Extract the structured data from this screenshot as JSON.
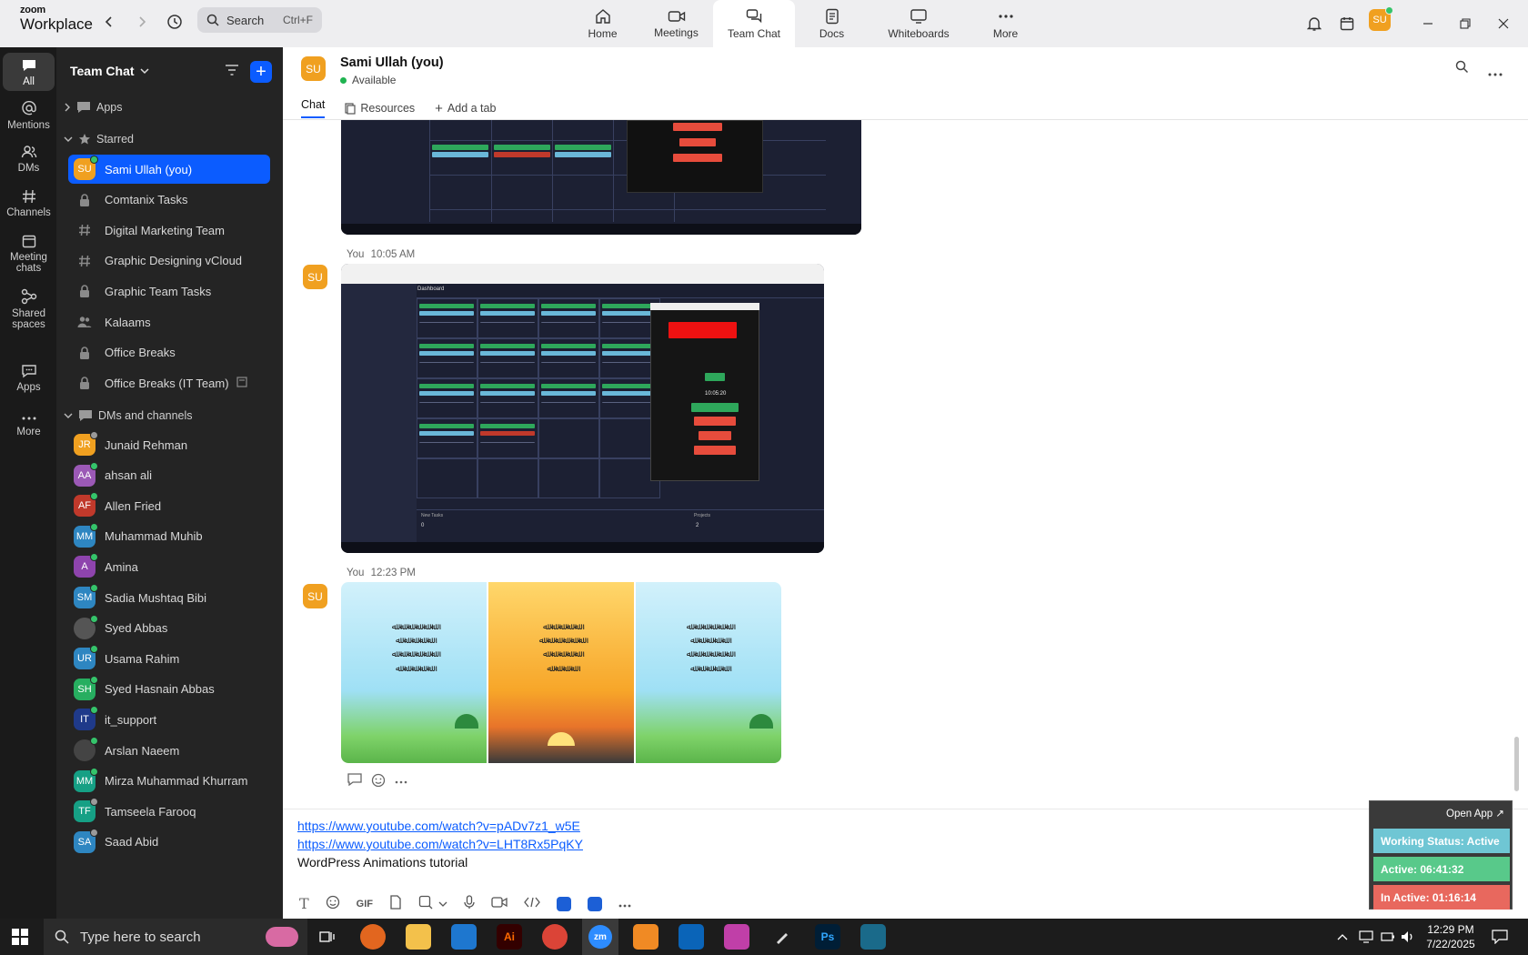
{
  "app": {
    "brand_top": "zoom",
    "brand_bottom": "Workplace",
    "search_label": "Search",
    "search_shortcut": "Ctrl+F",
    "user_initials": "SU"
  },
  "top_tabs": [
    {
      "label": "Home",
      "icon": "home-icon"
    },
    {
      "label": "Meetings",
      "icon": "video-icon"
    },
    {
      "label": "Team Chat",
      "icon": "chat-icon"
    },
    {
      "label": "Docs",
      "icon": "doc-icon"
    },
    {
      "label": "Whiteboards",
      "icon": "whiteboard-icon"
    },
    {
      "label": "More",
      "icon": "more-icon"
    }
  ],
  "rail": [
    {
      "label": "All"
    },
    {
      "label": "Mentions"
    },
    {
      "label": "DMs"
    },
    {
      "label": "Channels"
    },
    {
      "label": "Meeting chats"
    },
    {
      "label": "Shared spaces"
    },
    {
      "label": "Apps"
    },
    {
      "label": "More"
    }
  ],
  "sidebar": {
    "title": "Team Chat",
    "sections": {
      "apps": "Apps",
      "starred": "Starred",
      "dms": "DMs and channels"
    },
    "starred": [
      {
        "label": "Sami Ullah (you)",
        "type": "avatar",
        "initials": "SU",
        "color": "#f0a020",
        "status": "#35c46b",
        "selected": true
      },
      {
        "label": "Comtanix Tasks",
        "type": "lock"
      },
      {
        "label": "Digital Marketing Team",
        "type": "hash"
      },
      {
        "label": "Graphic Designing vCloud",
        "type": "hash"
      },
      {
        "label": "Graphic Team Tasks",
        "type": "lock"
      },
      {
        "label": "Kalaams",
        "type": "people"
      },
      {
        "label": "Office Breaks",
        "type": "lock"
      },
      {
        "label": "Office Breaks (IT Team)",
        "type": "lock"
      }
    ],
    "dms": [
      {
        "label": "Junaid Rehman",
        "initials": "JR",
        "color": "#f0a020",
        "status": "#9a9a9a"
      },
      {
        "label": "ahsan ali",
        "initials": "AA",
        "color": "#9b59b6",
        "status": "#35c46b"
      },
      {
        "label": "Allen Fried",
        "initials": "AF",
        "color": "#c0392b",
        "status": "#35c46b"
      },
      {
        "label": "Muhammad Muhib",
        "initials": "MM",
        "color": "#2e86c1",
        "status": "#35c46b"
      },
      {
        "label": "Amina",
        "initials": "A",
        "color": "#8e44ad",
        "status": "#35c46b"
      },
      {
        "label": "Sadia Mushtaq Bibi",
        "initials": "SM",
        "color": "#2e86c1",
        "status": "#35c46b"
      },
      {
        "label": "Syed Abbas",
        "initials": "",
        "color": "#555555",
        "status": "#35c46b"
      },
      {
        "label": "Usama Rahim",
        "initials": "UR",
        "color": "#2e86c1",
        "status": "#35c46b"
      },
      {
        "label": "Syed Hasnain Abbas",
        "initials": "SH",
        "color": "#27ae60",
        "status": "#35c46b"
      },
      {
        "label": "it_support",
        "initials": "IT",
        "color": "#1f3a8a",
        "status": "#35c46b"
      },
      {
        "label": "Arslan Naeem",
        "initials": "",
        "color": "#444444",
        "status": "#35c46b"
      },
      {
        "label": "Mirza Muhammad Khurram",
        "initials": "MM",
        "color": "#16a085",
        "status": "#35c46b"
      },
      {
        "label": "Tamseela Farooq",
        "initials": "TF",
        "color": "#16a085",
        "status": "#9a9a9a"
      },
      {
        "label": "Saad Abid",
        "initials": "SA",
        "color": "#2e86c1",
        "status": "#9a9a9a"
      }
    ]
  },
  "chat": {
    "name": "Sami Ullah (you)",
    "status": "Available",
    "initials": "SU",
    "tabs": [
      "Chat",
      "Resources",
      "Add a tab"
    ],
    "messages": [
      {
        "sender": "You",
        "time": "10:05 AM"
      },
      {
        "sender": "You",
        "time": "12:23 PM"
      }
    ],
    "screenshot_text": {
      "title": "Dashboard",
      "time": "10:05:20",
      "stat_left_label": "New Tasks",
      "stat_left_value": "0",
      "stat_right_label": "Projects",
      "stat_right_value": "2"
    }
  },
  "composer": {
    "link1": "https://www.youtube.com/watch?v=pADv7z1_w5E",
    "link2": "https://www.youtube.com/watch?v=LHT8Rx5PqKY",
    "text": "WordPress Animations tutorial",
    "gif": "GIF"
  },
  "widget": {
    "open": "Open App ↗",
    "working": "Working Status: Active",
    "active": "Active: 06:41:32",
    "inactive": "In Active: 01:16:14"
  },
  "taskbar": {
    "search_placeholder": "Type here to search",
    "time": "12:29 PM",
    "date": "7/22/2025"
  }
}
